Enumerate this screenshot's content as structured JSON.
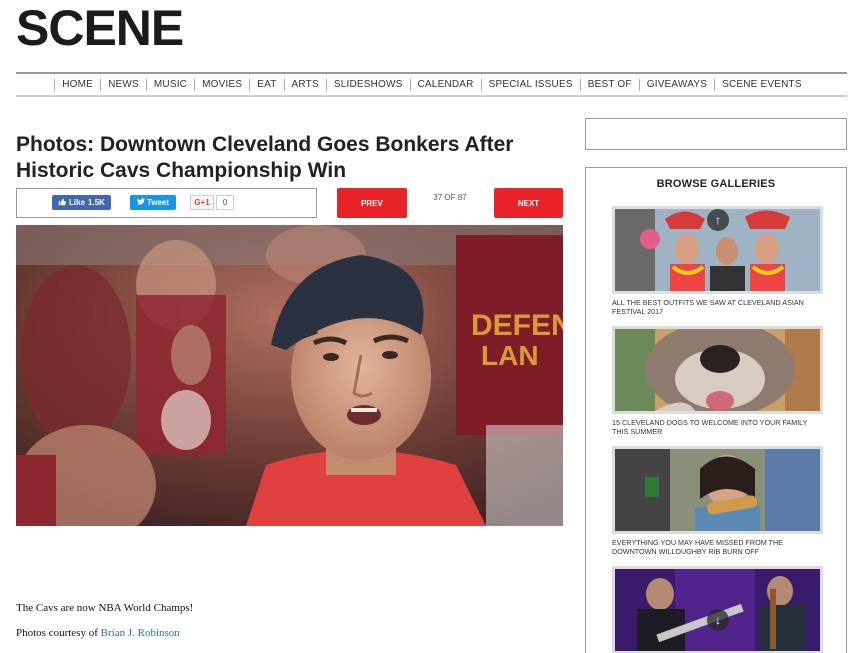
{
  "site": {
    "logo": "SCENE"
  },
  "nav": {
    "items": [
      "HOME",
      "NEWS",
      "MUSIC",
      "MOVIES",
      "EAT",
      "ARTS",
      "SLIDESHOWS",
      "CALENDAR",
      "SPECIAL ISSUES",
      "BEST OF",
      "GIVEAWAYS",
      "SCENE EVENTS"
    ]
  },
  "article": {
    "headline": "Photos: Downtown Cleveland Goes Bonkers After Historic Cavs Championship Win",
    "caption": "The Cavs are now NBA World Champs!",
    "credit_prefix": "Photos courtesy of ",
    "credit_name": "Brian J. Robinson"
  },
  "share": {
    "like_label": "Like",
    "like_count": "1.5K",
    "tweet_label": "Tweet",
    "gplus_label": "G+1",
    "gplus_count": "0"
  },
  "slideshow": {
    "prev_label": "PREV",
    "next_label": "NEXT",
    "counter": "37 OF 87"
  },
  "sidebar": {
    "gallery_title": "BROWSE GALLERIES",
    "galleries": [
      {
        "label": "ALL THE BEST OUTFITS WE SAW AT CLEVELAND ASIAN FESTIVAL 2017"
      },
      {
        "label": "15 CLEVELAND DOGS TO WELCOME INTO YOUR FAMILY THIS SUMMER"
      },
      {
        "label": "EVERYTHING YOU MAY HAVE MISSED FROM THE DOWNTOWN WILLOUGHBY RIB BURN OFF"
      },
      {
        "label": ""
      }
    ]
  },
  "colors": {
    "accent_red": "#e8232a",
    "facebook_blue": "#4267b2",
    "twitter_blue": "#1b95e0",
    "link_blue": "#2a6fb0"
  }
}
